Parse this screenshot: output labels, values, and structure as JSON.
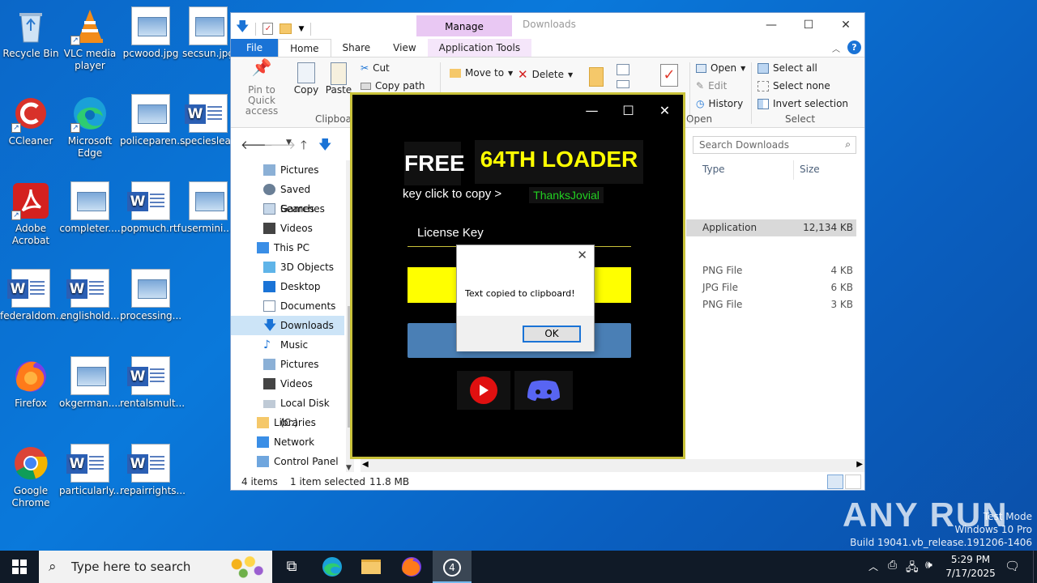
{
  "desktop": {
    "icons": [
      {
        "label": "Recycle Bin"
      },
      {
        "label": "VLC media player"
      },
      {
        "label": "pcwood.jpg"
      },
      {
        "label": "secsun.jpg"
      },
      {
        "label": "CCleaner"
      },
      {
        "label": "Microsoft Edge"
      },
      {
        "label": "policeparen..."
      },
      {
        "label": "specieslea..."
      },
      {
        "label": "Adobe Acrobat"
      },
      {
        "label": "completer...."
      },
      {
        "label": "popmuch.rtf"
      },
      {
        "label": "usermini...."
      },
      {
        "label": "federaldom..."
      },
      {
        "label": "englishold..."
      },
      {
        "label": "processing..."
      },
      {
        "label": "Firefox"
      },
      {
        "label": "okgerman...."
      },
      {
        "label": "rentalsmult..."
      },
      {
        "label": "Google Chrome"
      },
      {
        "label": "particularly..."
      },
      {
        "label": "repairrights..."
      }
    ]
  },
  "explorer": {
    "title": "Downloads",
    "manage": "Manage",
    "tabs": {
      "file": "File",
      "home": "Home",
      "share": "Share",
      "view": "View",
      "apptools": "Application Tools"
    },
    "ribbon": {
      "pin": "Pin to Quick access",
      "copy": "Copy",
      "paste": "Paste",
      "cut": "Cut",
      "copy_path": "Copy path",
      "clipboard": "Clipboard",
      "move_to": "Move to",
      "delete": "Delete",
      "open": "Open",
      "edit": "Edit",
      "history": "History",
      "open_group": "Open",
      "select_all": "Select all",
      "select_none": "Select none",
      "invert_selection": "Invert selection",
      "select_group": "Select"
    },
    "search_placeholder": "Search Downloads",
    "nav": [
      "Pictures",
      "Saved Games",
      "Searches",
      "Videos",
      "This PC",
      "3D Objects",
      "Desktop",
      "Documents",
      "Downloads",
      "Music",
      "Pictures",
      "Videos",
      "Local Disk (C:)",
      "Libraries",
      "Network",
      "Control Panel"
    ],
    "columns": {
      "type": "Type",
      "size": "Size"
    },
    "rows": [
      {
        "type": "Application",
        "size": "12,134 KB"
      },
      {
        "type": "PNG File",
        "size": "4 KB"
      },
      {
        "type": "JPG File",
        "size": "6 KB"
      },
      {
        "type": "PNG File",
        "size": "3 KB"
      }
    ],
    "status": {
      "items": "4 items",
      "selected": "1 item selected",
      "size": "11.8 MB"
    }
  },
  "loader": {
    "free": "FREE",
    "title": "64TH LOADER",
    "copy_text": "key click to copy  >",
    "thanks": "ThanksJovial",
    "license_label": "License Key"
  },
  "dialog": {
    "message": "Text copied to clipboard!",
    "ok": "OK"
  },
  "watermark": {
    "brand": "ANY RUN",
    "line1": "Test Mode",
    "line2": "Windows 10 Pro",
    "line3": "Build 19041.vb_release.191206-1406"
  },
  "taskbar": {
    "search_placeholder": "Type here to search",
    "time": "5:29 PM",
    "date": "7/17/2025"
  },
  "colors": {
    "accent": "#1a73d6",
    "loader_yellow": "#ffff00",
    "loader_green": "#22d022",
    "manage_pink": "#e9c8f3"
  }
}
